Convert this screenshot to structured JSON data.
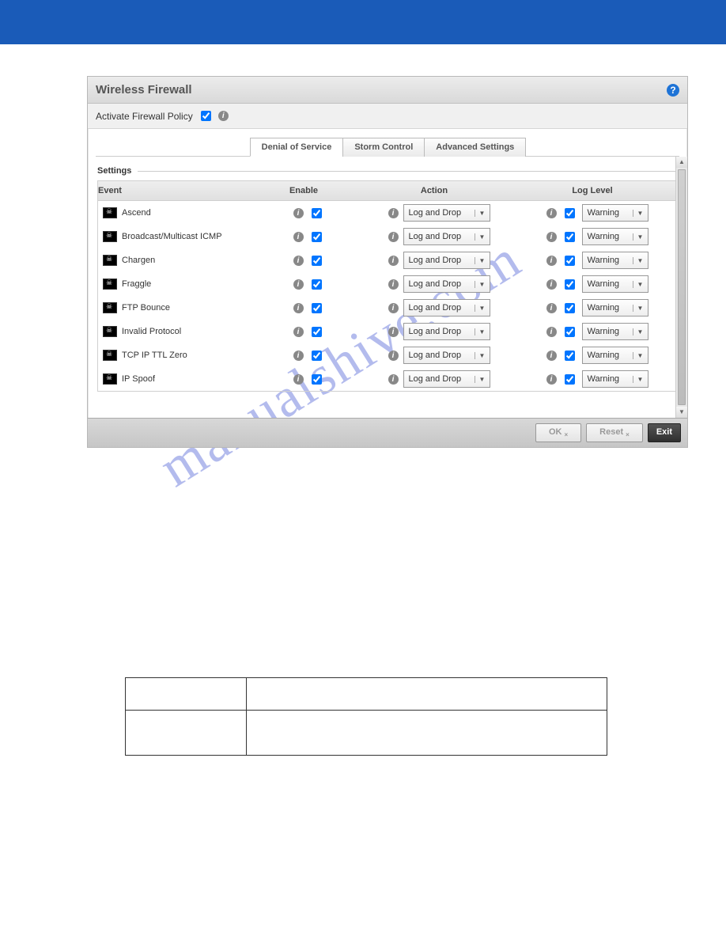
{
  "title": "Wireless Firewall",
  "activate_label": "Activate Firewall Policy",
  "activate_checked": true,
  "tabs": [
    {
      "label": "Denial of Service",
      "active": true
    },
    {
      "label": "Storm Control",
      "active": false
    },
    {
      "label": "Advanced Settings",
      "active": false
    }
  ],
  "section_label": "Settings",
  "headers": {
    "event": "Event",
    "enable": "Enable",
    "action": "Action",
    "loglevel": "Log Level"
  },
  "rows": [
    {
      "event": "Ascend",
      "enable": true,
      "action": "Log and Drop",
      "log_enable": true,
      "log": "Warning"
    },
    {
      "event": "Broadcast/Multicast ICMP",
      "enable": true,
      "action": "Log and Drop",
      "log_enable": true,
      "log": "Warning"
    },
    {
      "event": "Chargen",
      "enable": true,
      "action": "Log and Drop",
      "log_enable": true,
      "log": "Warning"
    },
    {
      "event": "Fraggle",
      "enable": true,
      "action": "Log and Drop",
      "log_enable": true,
      "log": "Warning"
    },
    {
      "event": "FTP Bounce",
      "enable": true,
      "action": "Log and Drop",
      "log_enable": true,
      "log": "Warning"
    },
    {
      "event": "Invalid Protocol",
      "enable": true,
      "action": "Log and Drop",
      "log_enable": true,
      "log": "Warning"
    },
    {
      "event": "TCP IP TTL Zero",
      "enable": true,
      "action": "Log and Drop",
      "log_enable": true,
      "log": "Warning"
    },
    {
      "event": "IP Spoof",
      "enable": true,
      "action": "Log and Drop",
      "log_enable": true,
      "log": "Warning"
    }
  ],
  "buttons": {
    "ok": "OK",
    "reset": "Reset",
    "exit": "Exit"
  },
  "watermark": "manualshive.com"
}
